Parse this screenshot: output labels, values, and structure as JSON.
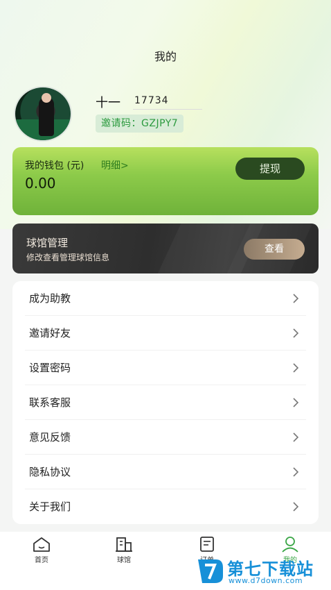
{
  "header": {
    "title": "我的"
  },
  "profile": {
    "name": "十一",
    "id": "17734",
    "invite_code": "邀请码：GZJPY7"
  },
  "wallet": {
    "label": "我的钱包 (元)",
    "detail_link": "明细>",
    "amount": "0.00",
    "withdraw_label": "提现"
  },
  "venue": {
    "title": "球馆管理",
    "subtitle": "修改查看管理球馆信息",
    "view_label": "查看"
  },
  "menu": {
    "items": [
      {
        "label": "成为助教"
      },
      {
        "label": "邀请好友"
      },
      {
        "label": "设置密码"
      },
      {
        "label": "联系客服"
      },
      {
        "label": "意见反馈"
      },
      {
        "label": "隐私协议"
      },
      {
        "label": "关于我们"
      }
    ]
  },
  "tabbar": {
    "tabs": [
      {
        "label": "首页",
        "icon": "home-icon"
      },
      {
        "label": "球馆",
        "icon": "building-icon"
      },
      {
        "label": "订单",
        "icon": "order-icon"
      },
      {
        "label": "我的",
        "icon": "user-icon"
      }
    ],
    "active_index": 3
  },
  "watermark": {
    "text": "第七下载站",
    "url": "www.d7down.com"
  },
  "colors": {
    "accent_green": "#3aa646",
    "wallet_green": "#8dcb4a",
    "withdraw_dark": "#2a4a20",
    "venue_dark": "#333333",
    "view_gold": "#c5ac90"
  }
}
